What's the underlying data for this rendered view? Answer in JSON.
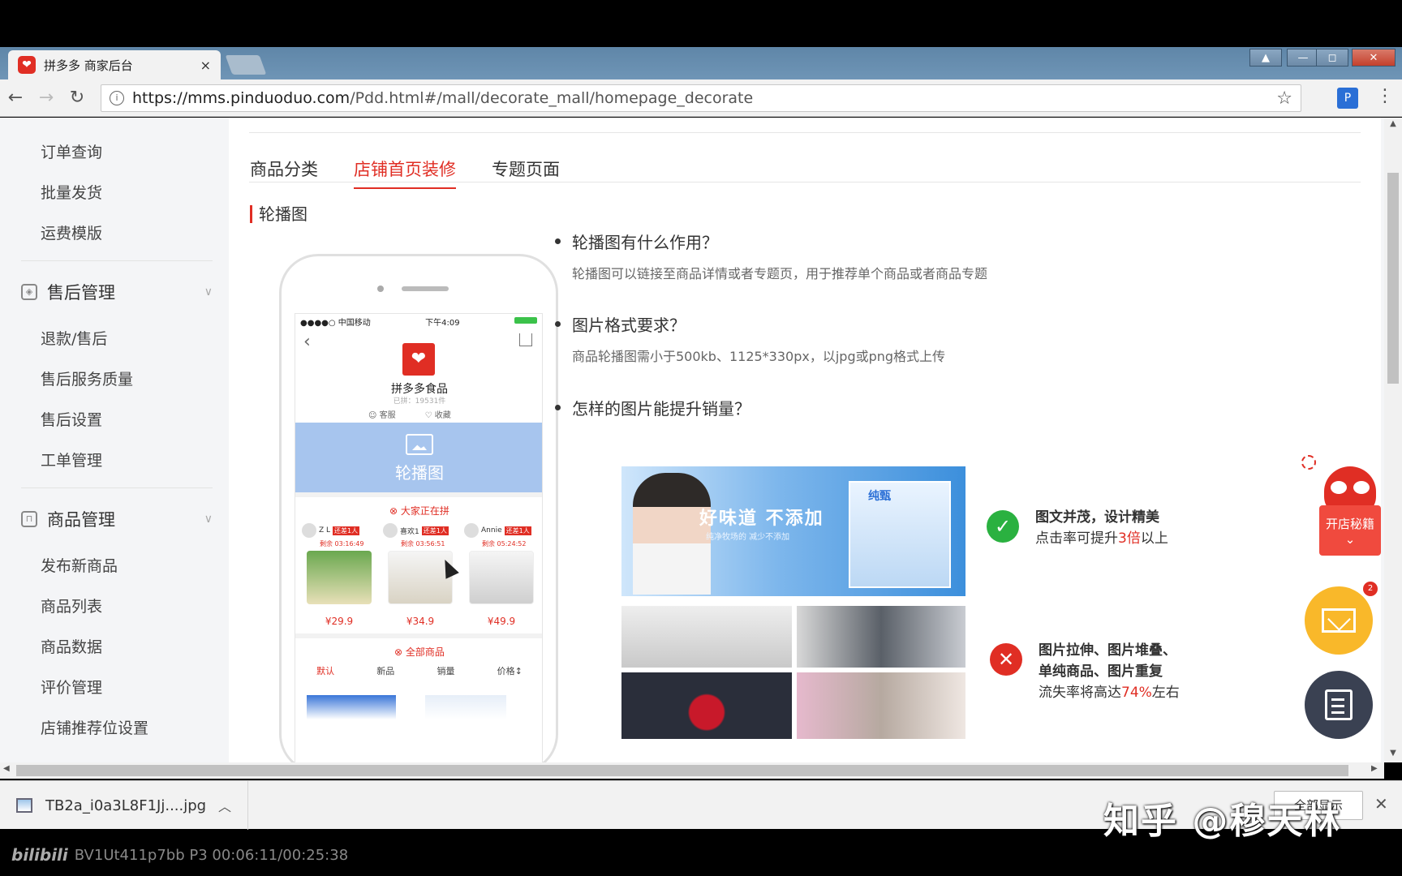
{
  "browser": {
    "tab_title": "拼多多 商家后台",
    "tab_close": "×",
    "url_host": "https://mms.pinduoduo.com",
    "url_path": "/Pdd.html#/mall/decorate_mall/homepage_decorate"
  },
  "sidebar": {
    "items_top": [
      "订单查询",
      "批量发货",
      "运费模版"
    ],
    "group_aftersale": {
      "label": "售后管理",
      "items": [
        "退款/售后",
        "售后服务质量",
        "售后设置",
        "工单管理"
      ]
    },
    "group_goods": {
      "label": "商品管理",
      "items": [
        "发布新商品",
        "商品列表",
        "商品数据",
        "评价管理",
        "店铺推荐位设置"
      ]
    }
  },
  "tabs": [
    "商品分类",
    "店铺首页装修",
    "专题页面"
  ],
  "active_tab": 1,
  "section_title": "轮播图",
  "phone": {
    "carrier": "●●●●○ 中国移动",
    "time": "下午4:09",
    "shop_name": "拼多多食品",
    "shop_fans": "已拼：19531件",
    "action_service": "客服",
    "action_fav": "收藏",
    "banner_label": "轮播图",
    "groupon_header": "大家正在拼",
    "groupon_users": [
      {
        "name": "Z L",
        "tag": "还差1人",
        "timer": "剩余 03:16:49"
      },
      {
        "name": "喜欢1",
        "tag": "还差1人",
        "timer": "剩余 03:56:51"
      },
      {
        "name": "Annie",
        "tag": "还差1人",
        "timer": "剩余 05:24:52"
      }
    ],
    "prices": [
      "¥29.9",
      "¥34.9",
      "¥49.9"
    ],
    "all_goods_header": "全部商品",
    "sort_options": [
      "默认",
      "新品",
      "销量",
      "价格↕"
    ]
  },
  "qa": [
    {
      "q": "轮播图有什么作用？",
      "a": "轮播图可以链接至商品详情或者专题页，用于推荐单个商品或者商品专题"
    },
    {
      "q": "图片格式要求？",
      "a": "商品轮播图需小于500kb、1125*330px，以jpg或png格式上传"
    },
    {
      "q": "怎样的图片能提升销量？",
      "a": ""
    }
  ],
  "good_example": {
    "slogan": "好味道 不添加",
    "sub": "纯净牧场的 减少不添加",
    "brand": "纯甄",
    "title": "图文并茂，设计精美",
    "line2_pre": "点击率可提升",
    "line2_hl": "3倍",
    "line2_post": "以上",
    "color": "#2ab140"
  },
  "bad_example": {
    "title1": "图片拉伸、图片堆叠、",
    "title2": "单纯商品、图片重复",
    "line3_pre": "流失率将高达",
    "line3_hl": "74%",
    "line3_post": "左右",
    "color": "#e02e24"
  },
  "widgets": {
    "mascot_label": "开店秘籍",
    "mail_badge": "2"
  },
  "download": {
    "filename": "TB2a_i0a3L8F1Jj....jpg",
    "show_all": "全部显示"
  },
  "watermark": "知乎 @穆天林",
  "video": {
    "logo": "bilibili",
    "info": "BV1Ut411p7bb P3 00:06:11/00:25:38"
  }
}
